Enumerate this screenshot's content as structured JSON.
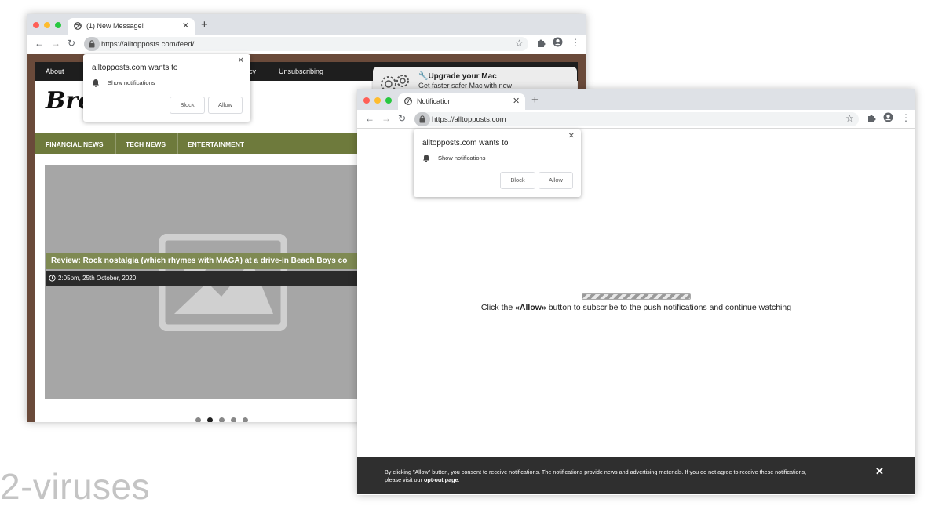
{
  "back_window": {
    "tab_title": "(1) New Message!",
    "url": "https://alltopposts.com/feed/",
    "popup": {
      "title": "alltopposts.com wants to",
      "item": "Show notifications",
      "block_label": "Block",
      "allow_label": "Allow"
    },
    "site": {
      "nav": [
        "About",
        "cy",
        "Unsubscribing"
      ],
      "logo": "Bre",
      "categories": [
        "FINANCIAL NEWS",
        "TECH NEWS",
        "ENTERTAINMENT"
      ],
      "caption": "Review: Rock nostalgia (which rhymes with MAGA) at a drive-in Beach Boys co",
      "date": "2:05pm, 25th October, 2020",
      "carousel_active_index": 1,
      "carousel_count": 5
    },
    "ad": {
      "title": "🔧Upgrade your Mac",
      "subtitle": "Get faster safer Mac with new"
    }
  },
  "front_window": {
    "tab_title": "Notification",
    "url": "https://alltopposts.com",
    "popup": {
      "title": "alltopposts.com wants to",
      "item": "Show notifications",
      "block_label": "Block",
      "allow_label": "Allow"
    },
    "cta": {
      "before": "Click the ",
      "bold": "«Allow»",
      "after": " button to subscribe to the push notifications and continue watching"
    },
    "cookie": {
      "text": "By clicking \"Allow\" button, you consent to receive notifications. The notifications provide news and advertising materials. If you do not agree to receive these notifications,",
      "text2": "please visit our ",
      "link": "opt-out page",
      "end": "."
    }
  },
  "watermark": "2-viruses",
  "colors": {
    "tabbar": "#dee1e6",
    "category_bar": "#6e7a3c",
    "site_frame": "#6a4a3a",
    "cookie_bar": "#2f2f2f"
  },
  "icons": [
    "globe-icon",
    "close-icon",
    "plus-icon",
    "back-arrow-icon",
    "forward-arrow-icon",
    "reload-icon",
    "lock-icon",
    "star-icon",
    "puzzle-icon",
    "account-icon",
    "menu-dots-icon",
    "bell-icon",
    "image-placeholder-icon",
    "clock-icon",
    "gears-icon"
  ]
}
